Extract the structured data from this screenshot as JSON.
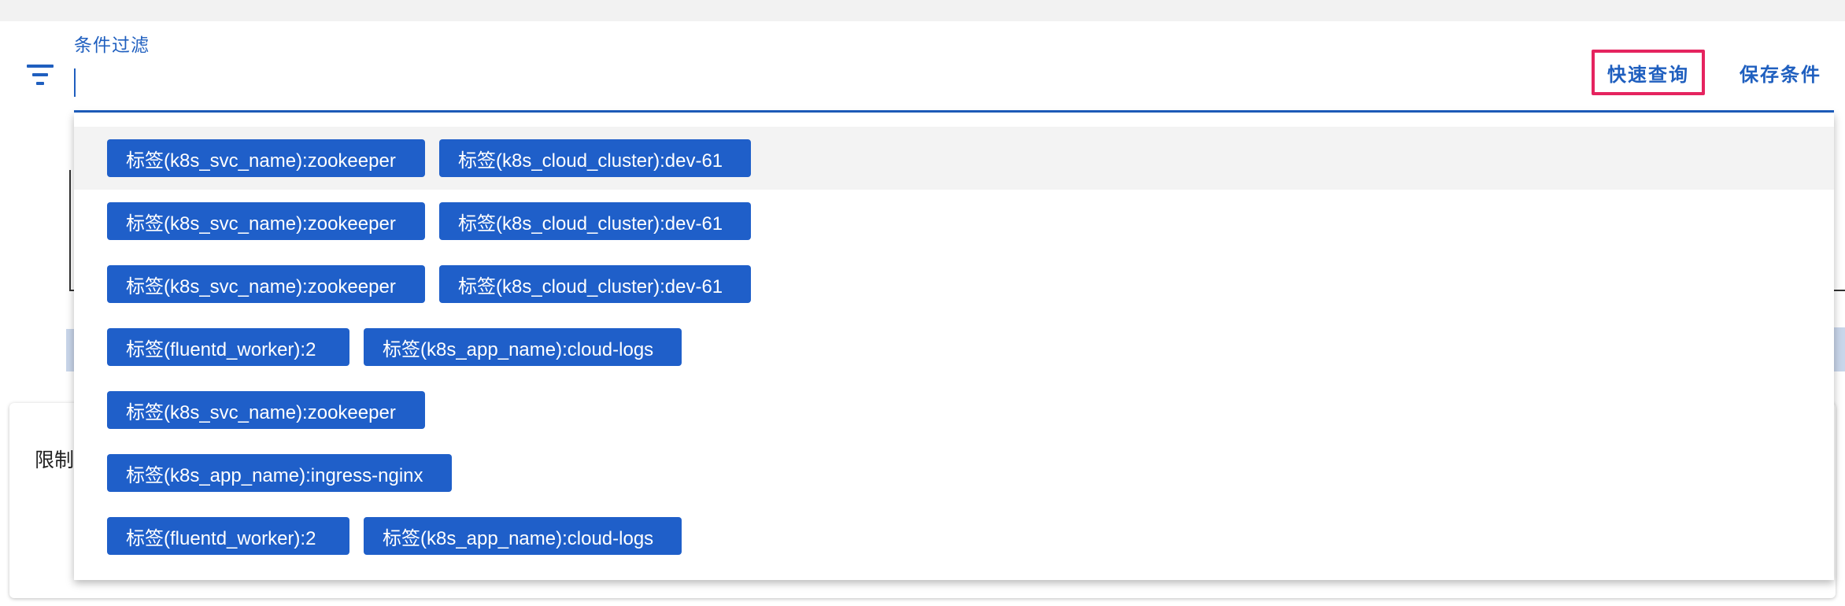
{
  "filter": {
    "label": "条件过滤",
    "icon": "filter-list-icon",
    "value": ""
  },
  "actions": {
    "quick_query": "快速查询",
    "save_condition": "保存条件"
  },
  "background": {
    "card_label": "限制"
  },
  "colors": {
    "primary": "#1f5fbf",
    "chip": "#1f5fc9",
    "highlight_border": "#e5245f"
  },
  "suggestions": [
    [
      "标签(k8s_svc_name):zookeeper",
      "标签(k8s_cloud_cluster):dev-61"
    ],
    [
      "标签(k8s_svc_name):zookeeper",
      "标签(k8s_cloud_cluster):dev-61"
    ],
    [
      "标签(k8s_svc_name):zookeeper",
      "标签(k8s_cloud_cluster):dev-61"
    ],
    [
      "标签(fluentd_worker):2",
      "标签(k8s_app_name):cloud-logs"
    ],
    [
      "标签(k8s_svc_name):zookeeper"
    ],
    [
      "标签(k8s_app_name):ingress-nginx"
    ],
    [
      "标签(fluentd_worker):2",
      "标签(k8s_app_name):cloud-logs"
    ]
  ]
}
